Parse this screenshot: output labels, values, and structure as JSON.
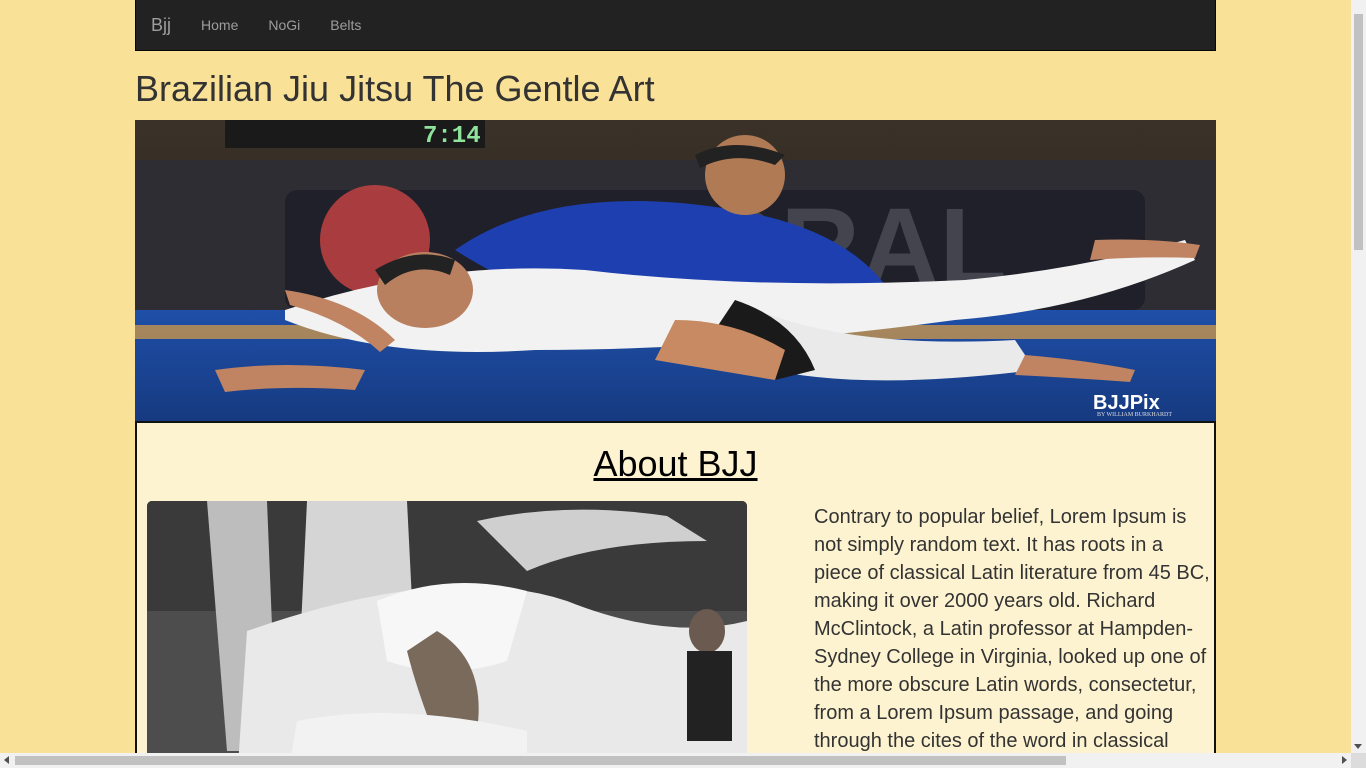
{
  "navbar": {
    "brand": "Bjj",
    "items": [
      {
        "label": "Home"
      },
      {
        "label": "NoGi"
      },
      {
        "label": "Belts"
      }
    ]
  },
  "header": {
    "title": "Brazilian Jiu Jitsu The Gentle Art"
  },
  "hero": {
    "scoreboard": "7:14",
    "watermark": "BJJPix",
    "watermark_sub": "BY WILLIAM BURKHARDT",
    "banner_text": "ORAL"
  },
  "about": {
    "heading": "About BJJ",
    "paragraph": "Contrary to popular belief, Lorem Ipsum is not simply random text. It has roots in a piece of classical Latin literature from 45 BC, making it over 2000 years old. Richard McClintock, a Latin professor at Hampden-Sydney College in Virginia, looked up one of the more obscure Latin words, consectetur, from a Lorem Ipsum passage, and going through the cites of the word in classical"
  },
  "colors": {
    "page_background": "#f9e198",
    "navbar_background": "#222222",
    "nav_text": "#9d9d9d",
    "about_background": "#fdf3d0"
  }
}
